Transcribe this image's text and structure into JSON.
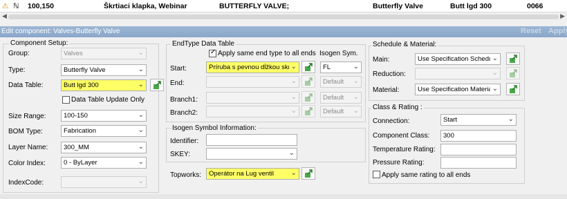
{
  "top_row": {
    "id": "100,150",
    "desc": "Škrtiaci klapka, Webinar",
    "spec": "BUTTERFLY VALVE;",
    "type": "Butterfly Valve",
    "table": "Butt lgd 300",
    "code": "0066"
  },
  "dialog": {
    "title": "Edit component: Valves-Butterfly Valve",
    "reset": "Reset",
    "apply": "Apply"
  },
  "component_setup": {
    "title": "Component Setup:",
    "group": {
      "label": "Group:",
      "value": "Valves"
    },
    "type": {
      "label": "Type:",
      "value": "Butterfly Valve"
    },
    "data_table": {
      "label": "Data Table:",
      "value": "Butt lgd 300"
    },
    "update_only": "Data Table Update Only",
    "size_range": {
      "label": "Size Range:",
      "value": "100-150"
    },
    "bom_type": {
      "label": "BOM Type:",
      "value": "Fabrication"
    },
    "layer_name": {
      "label": "Layer Name:",
      "value": "300_MM"
    },
    "color_index": {
      "label": "Color Index:",
      "value": "0 - ByLayer"
    },
    "index_code": {
      "label": "IndexCode:",
      "value": ""
    }
  },
  "endtype": {
    "title": "EndType Data Table",
    "same_end": "Apply same end type to all ends",
    "isogen_sym": "Isogen Sym.",
    "start": {
      "label": "Start:",
      "value": "Príruba s pevnou dĺžkou skru",
      "sym": "FL"
    },
    "end": {
      "label": "End:",
      "sym": "Default"
    },
    "branch1": {
      "label": "Branch1:",
      "sym": "Default"
    },
    "branch2": {
      "label": "Branch2:",
      "sym": "Default"
    }
  },
  "isogen": {
    "title": "Isogen Symbol Information:",
    "identifier": "Identifier:",
    "skey": "SKEY:"
  },
  "topworks": {
    "label": "Topworks:",
    "value": "Operátor na Lug ventil"
  },
  "schedule": {
    "title": "Schedule & Material:",
    "main": {
      "label": "Main:",
      "value": "Use Specification Schedule"
    },
    "reduction": {
      "label": "Reduction:"
    },
    "material": {
      "label": "Material:",
      "value": "Use Specification Material"
    }
  },
  "rating": {
    "title": "Class & Rating :",
    "connection": {
      "label": "Connection:",
      "value": "Start"
    },
    "component_class": {
      "label": "Component Class:",
      "value": "300"
    },
    "temp_rating": {
      "label": "Temperature Rating:"
    },
    "pressure_rating": {
      "label": "Pressure Rating:"
    },
    "same_rating": "Apply same rating to all ends"
  },
  "colors": {
    "highlight": "#ffff66",
    "titlebar": "#8aa7c9"
  }
}
